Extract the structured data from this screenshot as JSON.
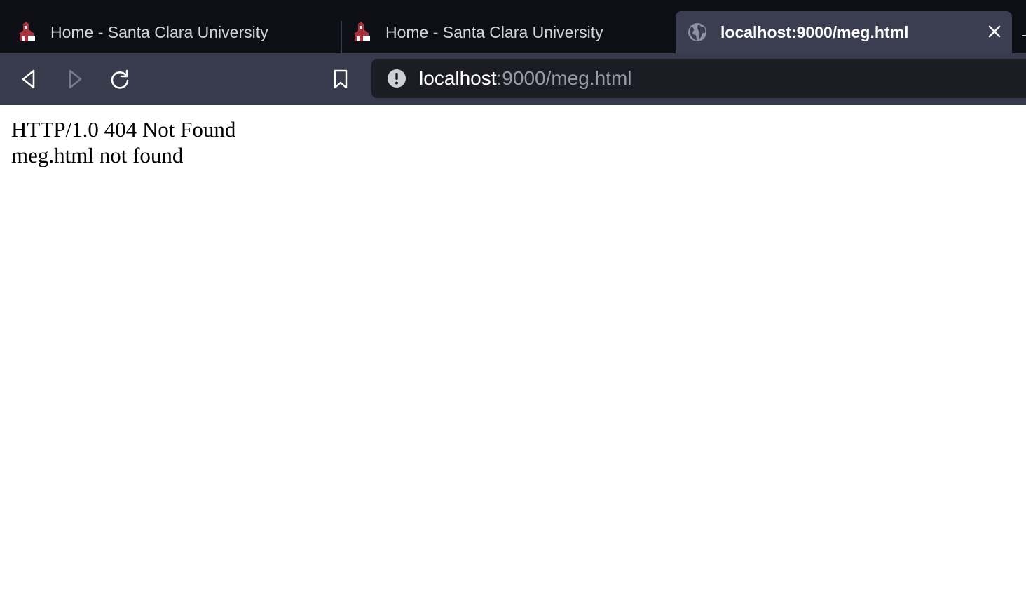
{
  "browser": {
    "tabs": [
      {
        "title": "Home - Santa Clara University",
        "icon": "scu-mission-icon",
        "active": false
      },
      {
        "title": "Home - Santa Clara University",
        "icon": "scu-mission-icon",
        "active": false
      },
      {
        "title": "localhost:9000/meg.html",
        "icon": "globe-icon",
        "active": true
      }
    ],
    "toolbar": {
      "url_host": "localhost",
      "url_rest": ":9000/meg.html"
    },
    "colors": {
      "tabstrip_bg": "#0e0e17",
      "toolbar_bg": "#373b4c",
      "urlbar_bg": "#1c1c25",
      "favicon_red": "#a8323e"
    }
  },
  "page": {
    "status_line": "HTTP/1.0 404 Not Found",
    "message": "meg.html not found"
  }
}
